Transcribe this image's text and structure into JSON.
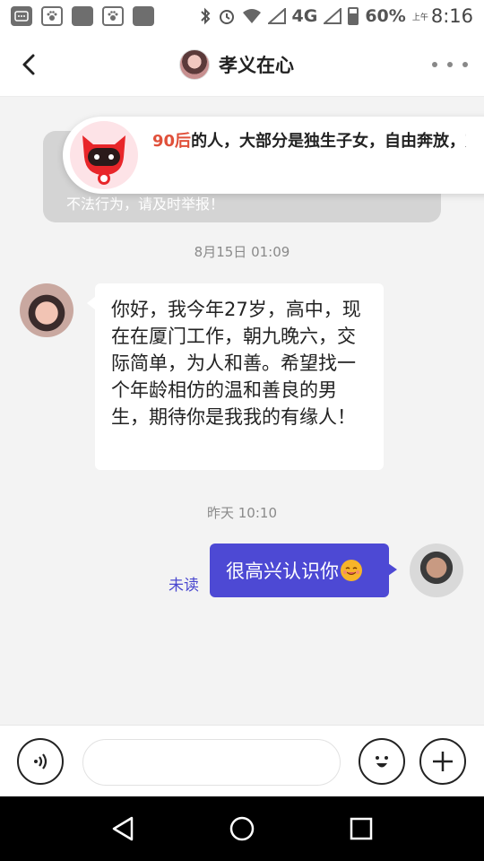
{
  "status_bar": {
    "battery": "60%",
    "time": "8:16",
    "ampm": "上午",
    "network": "4G"
  },
  "header": {
    "title": "孝义在心"
  },
  "warning": {
    "text": "不法行为，请及时举报！"
  },
  "promo": {
    "highlight": "90后",
    "text": "的人，大部分是独生子女，自由奔放，对未来乐观，是很有朝气和希望的..."
  },
  "chat": {
    "timestamp_1": "8月15日 01:09",
    "incoming_message": "你好，我今年27岁，高中，现在在厦门工作，朝九晚六，交际简单，为人和善。希望找一个年龄相仿的温和善良的男生，期待你是我我的有缘人！",
    "timestamp_2": "昨天 10:10",
    "outgoing_message": "很高兴认识你",
    "read_status": "未读"
  },
  "input": {
    "placeholder": ""
  },
  "colors": {
    "accent": "#4d49d4",
    "highlight": "#e0503a"
  }
}
